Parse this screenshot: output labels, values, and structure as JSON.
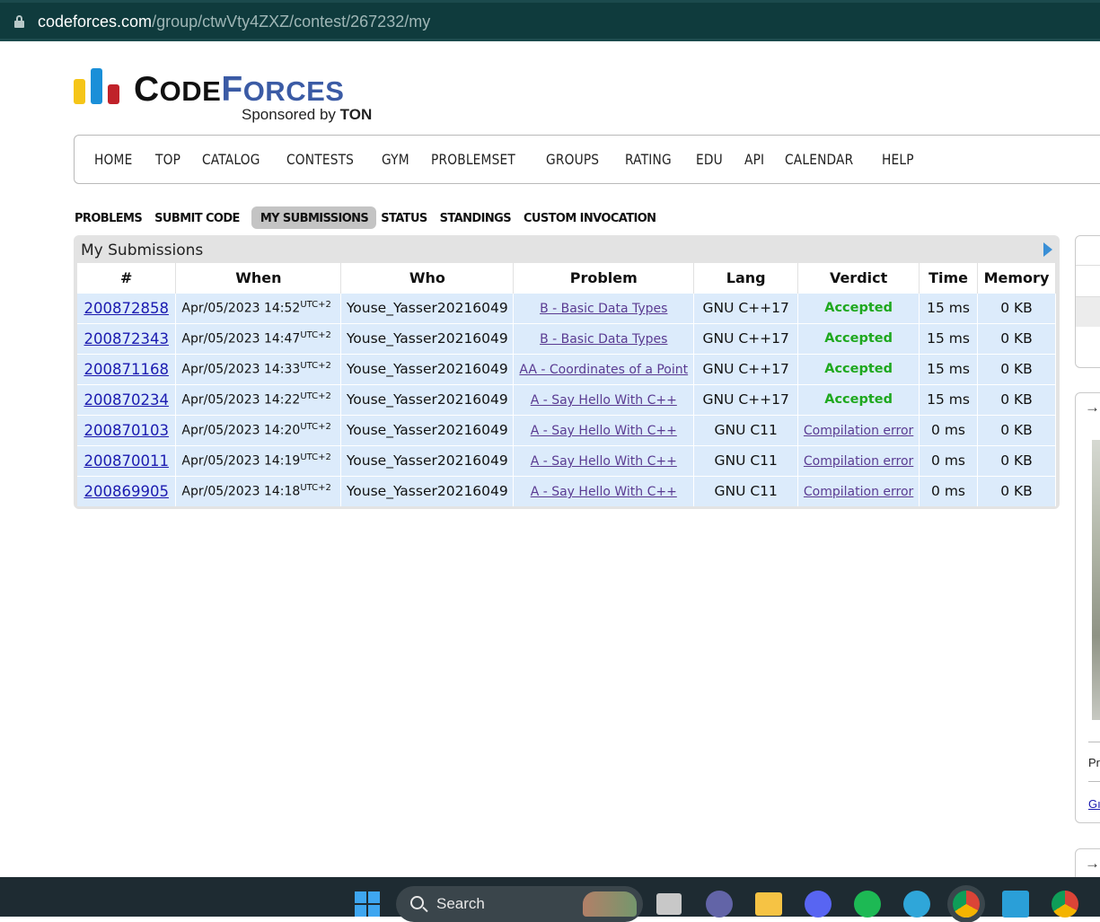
{
  "browser": {
    "url_host": "codeforces.com",
    "url_path": "/group/ctwVty4ZXZ/contest/267232/my"
  },
  "logo": {
    "code_letter": "C",
    "code_rest": "ODE",
    "forces_letter": "F",
    "forces_rest": "ORCES",
    "sponsor_prefix": "Sponsored by ",
    "sponsor_name": "TON"
  },
  "menu": [
    "HOME",
    "TOP",
    "CATALOG",
    "CONTESTS",
    "GYM",
    "PROBLEMSET",
    "GROUPS",
    "RATING",
    "EDU",
    "API",
    "CALENDAR",
    "HELP"
  ],
  "subnav": {
    "items": [
      "PROBLEMS",
      "SUBMIT CODE",
      "MY SUBMISSIONS",
      "STATUS",
      "STANDINGS",
      "CUSTOM INVOCATION"
    ],
    "active": "MY SUBMISSIONS"
  },
  "submissions": {
    "title": "My Submissions",
    "columns": [
      "#",
      "When",
      "Who",
      "Problem",
      "Lang",
      "Verdict",
      "Time",
      "Memory"
    ],
    "rows": [
      {
        "id": "200872858",
        "when": "Apr/05/2023 14:52",
        "tz": "UTC+2",
        "who": "Youse_Yasser20216049",
        "problem": "B - Basic Data Types",
        "lang": "GNU C++17",
        "verdict": "Accepted",
        "time": "15 ms",
        "memory": "0 KB"
      },
      {
        "id": "200872343",
        "when": "Apr/05/2023 14:47",
        "tz": "UTC+2",
        "who": "Youse_Yasser20216049",
        "problem": "B - Basic Data Types",
        "lang": "GNU C++17",
        "verdict": "Accepted",
        "time": "15 ms",
        "memory": "0 KB"
      },
      {
        "id": "200871168",
        "when": "Apr/05/2023 14:33",
        "tz": "UTC+2",
        "who": "Youse_Yasser20216049",
        "problem": "AA - Coordinates of a Point",
        "lang": "GNU C++17",
        "verdict": "Accepted",
        "time": "15 ms",
        "memory": "0 KB"
      },
      {
        "id": "200870234",
        "when": "Apr/05/2023 14:22",
        "tz": "UTC+2",
        "who": "Youse_Yasser20216049",
        "problem": "A - Say Hello With C++",
        "lang": "GNU C++17",
        "verdict": "Accepted",
        "time": "15 ms",
        "memory": "0 KB"
      },
      {
        "id": "200870103",
        "when": "Apr/05/2023 14:20",
        "tz": "UTC+2",
        "who": "Youse_Yasser20216049",
        "problem": "A - Say Hello With C++",
        "lang": "GNU C11",
        "verdict": "Compilation error",
        "time": "0 ms",
        "memory": "0 KB"
      },
      {
        "id": "200870011",
        "when": "Apr/05/2023 14:19",
        "tz": "UTC+2",
        "who": "Youse_Yasser20216049",
        "problem": "A - Say Hello With C++",
        "lang": "GNU C11",
        "verdict": "Compilation error",
        "time": "0 ms",
        "memory": "0 KB"
      },
      {
        "id": "200869905",
        "when": "Apr/05/2023 14:18",
        "tz": "UTC+2",
        "who": "Youse_Yasser20216049",
        "problem": "A - Say Hello With C++",
        "lang": "GNU C11",
        "verdict": "Compilation error",
        "time": "0 ms",
        "memory": "0 KB"
      }
    ]
  },
  "sidebar": {
    "arrow": "→",
    "pr_text": "Pr",
    "gl_text": "Gı"
  },
  "taskbar": {
    "search_label": "Search",
    "icons": [
      "windows-start-icon",
      "task-view-icon",
      "teams-icon",
      "file-explorer-icon",
      "discord-icon",
      "spotify-icon",
      "edge-icon",
      "chrome-icon",
      "launcher-l-icon",
      "chrome-profile-icon"
    ]
  },
  "colors": {
    "accepted": "#1ea81e",
    "link": "#1b1bb0",
    "problem_link": "#5a3b92",
    "row_bg": "#dcebfb",
    "brand_blue": "#3b5ba5"
  }
}
